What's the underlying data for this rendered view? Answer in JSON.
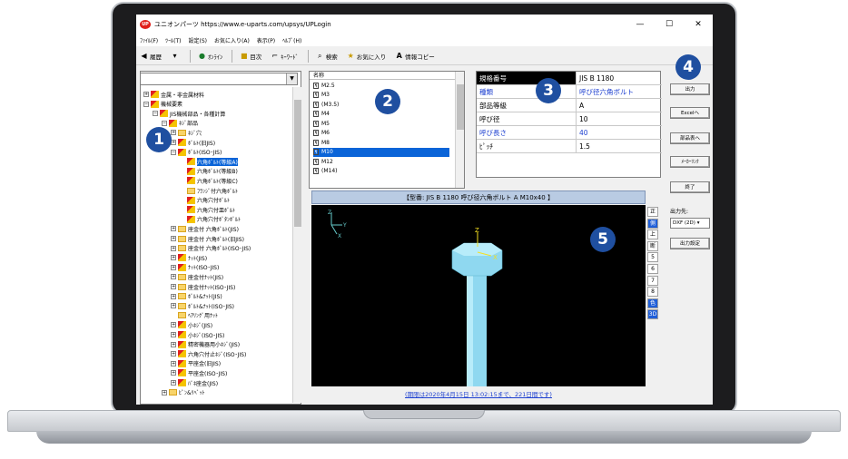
{
  "window": {
    "title": "ユニオンパーツ https://www.e-uparts.com/upsys/UPLogin",
    "min": "—",
    "max": "☐",
    "close": "✕",
    "app_icon": "UP"
  },
  "menu": [
    "ﾌｧｲﾙ(F)",
    "ﾂｰﾙ(T)",
    "設定(S)",
    "お気に入り(A)",
    "表示(P)",
    "ﾍﾙﾌﾟ(H)"
  ],
  "toolbar": {
    "history": "履歴",
    "online": "ｵﾝﾗｲﾝ",
    "contents": "目次",
    "keyword": "ｷｰﾜｰﾄﾞ",
    "search": "検索",
    "favorites": "お気に入り",
    "info_copy": "情報コピー"
  },
  "tree": [
    {
      "label": "金属・非金属材料",
      "level": 0,
      "pm": "+",
      "icon": "ruler"
    },
    {
      "label": "機械要素",
      "level": 0,
      "pm": "−",
      "icon": "ruler"
    },
    {
      "label": "JIS機械部品・各種計算",
      "level": 1,
      "pm": "−",
      "icon": "ruler"
    },
    {
      "label": "ﾈｼﾞ部品",
      "level": 2,
      "pm": "−",
      "icon": "ruler"
    },
    {
      "label": "ﾈｼﾞ穴",
      "level": 3,
      "pm": "+",
      "icon": "folder"
    },
    {
      "label": "ﾎﾞﾙﾄ(旧JIS)",
      "level": 3,
      "pm": "+",
      "icon": "ruler"
    },
    {
      "label": "ﾎﾞﾙﾄ(ISO･JIS)",
      "level": 3,
      "pm": "−",
      "icon": "ruler"
    },
    {
      "label": "六角ﾎﾞﾙﾄ(等級A)",
      "level": 4,
      "pm": "",
      "icon": "ruler",
      "selected": true
    },
    {
      "label": "六角ﾎﾞﾙﾄ(等級B)",
      "level": 4,
      "pm": "",
      "icon": "ruler"
    },
    {
      "label": "六角ﾎﾞﾙﾄ(等級C)",
      "level": 4,
      "pm": "",
      "icon": "ruler"
    },
    {
      "label": "ﾌﾗﾝｼﾞ付六角ﾎﾞﾙﾄ",
      "level": 4,
      "pm": "",
      "icon": "folder"
    },
    {
      "label": "六角穴付ﾎﾞﾙﾄ",
      "level": 4,
      "pm": "",
      "icon": "ruler"
    },
    {
      "label": "六角穴付皿ﾎﾞﾙﾄ",
      "level": 4,
      "pm": "",
      "icon": "ruler"
    },
    {
      "label": "六角穴付ﾎﾞﾀﾝﾎﾞﾙﾄ",
      "level": 4,
      "pm": "",
      "icon": "ruler"
    },
    {
      "label": "座金付 六角ﾎﾞﾙﾄ(JIS)",
      "level": 3,
      "pm": "+",
      "icon": "folder"
    },
    {
      "label": "座金付 六角ﾎﾞﾙﾄ(旧JIS)",
      "level": 3,
      "pm": "+",
      "icon": "folder"
    },
    {
      "label": "座金付 六角ﾎﾞﾙﾄ(ISO･JIS)",
      "level": 3,
      "pm": "+",
      "icon": "folder"
    },
    {
      "label": "ﾅｯﾄ(JIS)",
      "level": 3,
      "pm": "+",
      "icon": "ruler"
    },
    {
      "label": "ﾅｯﾄ(ISO･JIS)",
      "level": 3,
      "pm": "+",
      "icon": "ruler"
    },
    {
      "label": "座金付ﾅｯﾄ(JIS)",
      "level": 3,
      "pm": "+",
      "icon": "folder"
    },
    {
      "label": "座金付ﾅｯﾄ(ISO･JIS)",
      "level": 3,
      "pm": "+",
      "icon": "folder"
    },
    {
      "label": "ﾎﾞﾙﾄ&ﾅｯﾄ(JIS)",
      "level": 3,
      "pm": "+",
      "icon": "folder"
    },
    {
      "label": "ﾎﾞﾙﾄ&ﾅｯﾄ(ISO･JIS)",
      "level": 3,
      "pm": "+",
      "icon": "folder"
    },
    {
      "label": "ﾍｱﾘﾝｸﾞ用ﾅｯﾄ",
      "level": 3,
      "pm": "",
      "icon": "folder"
    },
    {
      "label": "小ﾈｼﾞ(JIS)",
      "level": 3,
      "pm": "+",
      "icon": "ruler"
    },
    {
      "label": "小ﾈｼﾞ(ISO･JIS)",
      "level": 3,
      "pm": "+",
      "icon": "ruler"
    },
    {
      "label": "精密機器用小ﾈｼﾞ(JIS)",
      "level": 3,
      "pm": "+",
      "icon": "ruler"
    },
    {
      "label": "六角穴付止ﾈｼﾞ(ISO･JIS)",
      "level": 3,
      "pm": "+",
      "icon": "ruler"
    },
    {
      "label": "平座金(旧JIS)",
      "level": 3,
      "pm": "+",
      "icon": "ruler"
    },
    {
      "label": "平座金(ISO･JIS)",
      "level": 3,
      "pm": "+",
      "icon": "ruler"
    },
    {
      "label": "ﾊﾞﾈ座金(JIS)",
      "level": 3,
      "pm": "+",
      "icon": "ruler"
    },
    {
      "label": "ﾋﾟﾝ&ﾘﾍﾞｯﾄ",
      "level": 2,
      "pm": "+",
      "icon": "folder"
    }
  ],
  "list": {
    "header": "名称",
    "items": [
      "M2.5",
      "M3",
      "(M3.5)",
      "M4",
      "M5",
      "M6",
      "M8",
      "M10",
      "M12",
      "(M14)"
    ],
    "selected": "M10"
  },
  "props": [
    {
      "k": "規格番号",
      "v": "JIS B 1180",
      "dark": true
    },
    {
      "k": "種類",
      "v": "呼び径六角ボルト",
      "blue": true
    },
    {
      "k": "部品等級",
      "v": "A"
    },
    {
      "k": "呼び径",
      "v": "10"
    },
    {
      "k": "呼び長さ",
      "v": "40",
      "blue": true
    },
    {
      "k": "ﾋﾟｯﾁ",
      "v": "1.5"
    }
  ],
  "actions": {
    "output": "出力",
    "excel": "Excelへ",
    "parts_table": "部品表へ",
    "maker_link": "ﾒｰｶｰﾘﾝｸ",
    "exit": "終了",
    "dest_label": "出力先:",
    "dest_value": "DXF (2D)",
    "settings": "出力設定"
  },
  "view": {
    "header": "【型番: JIS B 1180 呼び径六角ボルト A M10x40 】",
    "footer": "(期限は2020年4月15日 13:02:15まで、221日間です)",
    "side": [
      "正",
      "側",
      "上",
      "断",
      "5",
      "6",
      "7",
      "8",
      "色",
      "3D"
    ],
    "active_side": [
      "側",
      "色",
      "3D"
    ]
  },
  "badges": [
    "1",
    "2",
    "3",
    "4",
    "5"
  ],
  "colors": {
    "accent": "#1f4fa0",
    "selection": "#0a64d8",
    "bolt": "#8fd8f0"
  }
}
